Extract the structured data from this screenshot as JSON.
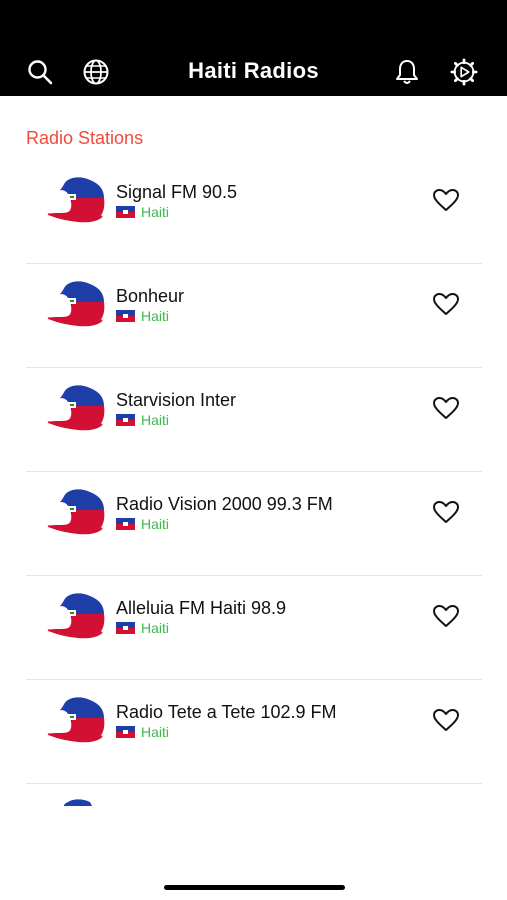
{
  "header": {
    "title": "Haiti Radios",
    "icons": [
      "search-icon",
      "globe-icon",
      "bell-icon",
      "settings-play-icon"
    ]
  },
  "section": {
    "title": "Radio Stations"
  },
  "stations": [
    {
      "name": "Signal FM 90.5",
      "country": "Haiti"
    },
    {
      "name": "Bonheur",
      "country": "Haiti"
    },
    {
      "name": "Starvision Inter",
      "country": "Haiti"
    },
    {
      "name": "Radio Vision 2000 99.3 FM",
      "country": "Haiti"
    },
    {
      "name": "Alleluia FM Haiti 98.9",
      "country": "Haiti"
    },
    {
      "name": "Radio Tete a Tete 102.9 FM",
      "country": "Haiti"
    }
  ],
  "colors": {
    "header_bg": "#000000",
    "section_title": "#f04a3a",
    "country_label": "#3cb94a",
    "flag_blue": "#1f3fa8",
    "flag_red": "#d21034"
  }
}
